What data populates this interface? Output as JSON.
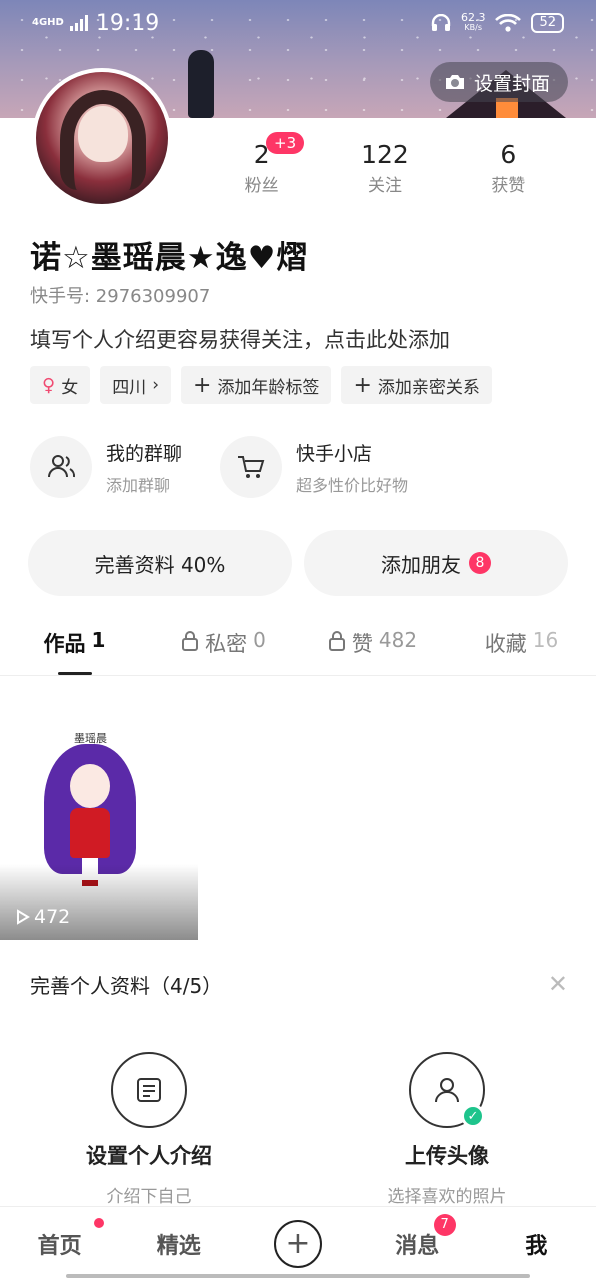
{
  "status_bar": {
    "network": "4GHD",
    "time": "19:19",
    "speed": "62.3",
    "speed_unit": "KB/s",
    "battery": "52"
  },
  "cover": {
    "set_cover_label": "设置封面"
  },
  "profile": {
    "name": "诺☆墨瑶晨★逸♥熠",
    "kuaishou_id": "快手号: 2976309907",
    "intro": "填写个人介绍更容易获得关注，点击此处添加",
    "stats": [
      {
        "num": "2",
        "label": "粉丝",
        "badge": "+3"
      },
      {
        "num": "122",
        "label": "关注"
      },
      {
        "num": "6",
        "label": "获赞"
      }
    ],
    "tags": [
      {
        "label": "女",
        "icon": "female-icon"
      },
      {
        "label": "四川",
        "icon": "chevron-right-icon"
      },
      {
        "label": "添加年龄标签",
        "icon": "plus-icon"
      },
      {
        "label": "添加亲密关系",
        "icon": "plus-icon"
      }
    ]
  },
  "entries": [
    {
      "title": "我的群聊",
      "sub": "添加群聊",
      "icon": "group-icon"
    },
    {
      "title": "快手小店",
      "sub": "超多性价比好物",
      "icon": "cart-icon"
    }
  ],
  "actions": {
    "complete_label": "完善资料 40%",
    "add_friend_label": "添加朋友",
    "add_friend_badge": "8"
  },
  "tabs": [
    {
      "label": "作品",
      "count": "1"
    },
    {
      "label": "私密",
      "count": "0",
      "icon": "lock-icon"
    },
    {
      "label": "赞",
      "count": "482",
      "icon": "lock-icon"
    },
    {
      "label": "收藏",
      "count": "16"
    }
  ],
  "video": {
    "caption": "墨瑶晨",
    "plays": "472"
  },
  "complete_profile": {
    "title": "完善个人资料（4/5）",
    "cards": [
      {
        "title": "设置个人介绍",
        "sub": "介绍下自己",
        "icon": "document-icon"
      },
      {
        "title": "上传头像",
        "sub": "选择喜欢的照片",
        "icon": "user-icon"
      }
    ]
  },
  "bottom_nav": {
    "home": "首页",
    "featured": "精选",
    "messages": "消息",
    "messages_badge": "7",
    "me": "我"
  }
}
